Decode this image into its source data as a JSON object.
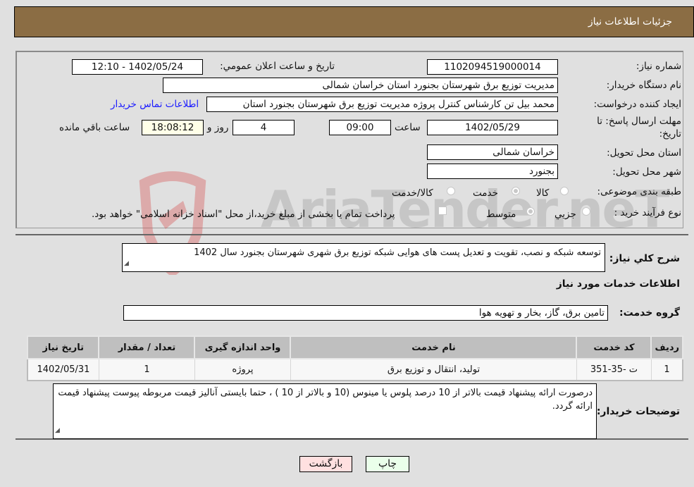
{
  "header": {
    "title": "جزئیات اطلاعات نیاز"
  },
  "fields": {
    "need_number": {
      "label": "شماره نیاز:",
      "value": "1102094519000014"
    },
    "announce_datetime": {
      "label": "تاریخ و ساعت اعلان عمومي:",
      "value": "1402/05/24 - 12:10"
    },
    "buyer_org": {
      "label": "نام دستگاه خریدار:",
      "value": "مدیریت توزیع برق شهرستان بجنورد استان خراسان شمالی"
    },
    "requester": {
      "label": "ایجاد کننده درخواست:",
      "value": "محمد بیل تن   کارشناس کنترل پروژه مدیریت توزیع برق شهرستان بجنورد استان",
      "contact_link": "اطلاعات تماس خریدار"
    },
    "deadline": {
      "label_line1": "مهلت ارسال پاسخ: تا",
      "label_line2": "تاریخ:",
      "date": "1402/05/29",
      "time_label": "ساعت",
      "time": "09:00",
      "days": "4",
      "days_label": "روز و",
      "remaining": "18:08:12",
      "remaining_label": "ساعت باقي مانده"
    },
    "delivery_province": {
      "label": "استان محل تحویل:",
      "value": "خراسان شمالی"
    },
    "delivery_city": {
      "label": "شهر محل تحویل:",
      "value": "بجنورد"
    },
    "category": {
      "label": "طبقه بندی موضوعی:",
      "options": [
        {
          "label": "کالا",
          "selected": false
        },
        {
          "label": "خدمت",
          "selected": true
        },
        {
          "label": "کالا/خدمت",
          "selected": false
        }
      ]
    },
    "purchase_type": {
      "label": "نوع فرآیند خرید :",
      "options": [
        {
          "label": "جزيي",
          "selected": false
        },
        {
          "label": "متوسط",
          "selected": true
        }
      ],
      "treasury_note": "پرداخت تمام یا بخشی از مبلغ خرید،از محل \"اسناد خزانه اسلامی\" خواهد بود.",
      "treasury_checked": false
    }
  },
  "summary": {
    "label": "شرح كلي نياز:",
    "value": "توسعه شبکه و نصب، تقویت و تعدیل پست های هوایی شبکه توزیع برق شهری شهرستان بجنورد سال 1402"
  },
  "services_section": {
    "title": "اطلاعات خدمات مورد نیاز",
    "group_label": "گروه خدمت:",
    "group_value": "تامین برق، گاز، بخار و تهویه هوا"
  },
  "table": {
    "headers": [
      "ردیف",
      "کد خدمت",
      "نام خدمت",
      "واحد اندازه گیری",
      "تعداد / مقدار",
      "تاریخ نیاز"
    ],
    "rows": [
      [
        "1",
        "ت -35-351",
        "تولید، انتقال و توزیع برق",
        "پروژه",
        "1",
        "1402/05/31"
      ]
    ]
  },
  "buyer_notes": {
    "label": "توضیحات خریدار:",
    "value": "درصورت ارائه پیشنهاد قیمت بالاتر از 10 درصد پلوس یا مینوس (10 و بالاتر از 10 ) ، حتما بایستی آنالیز قیمت مربوطه پیوست پیشنهاد قیمت ارائه گردد."
  },
  "buttons": {
    "print": "چاپ",
    "back": "بازگشت"
  },
  "watermark": {
    "text": "AriaTender.neT"
  }
}
